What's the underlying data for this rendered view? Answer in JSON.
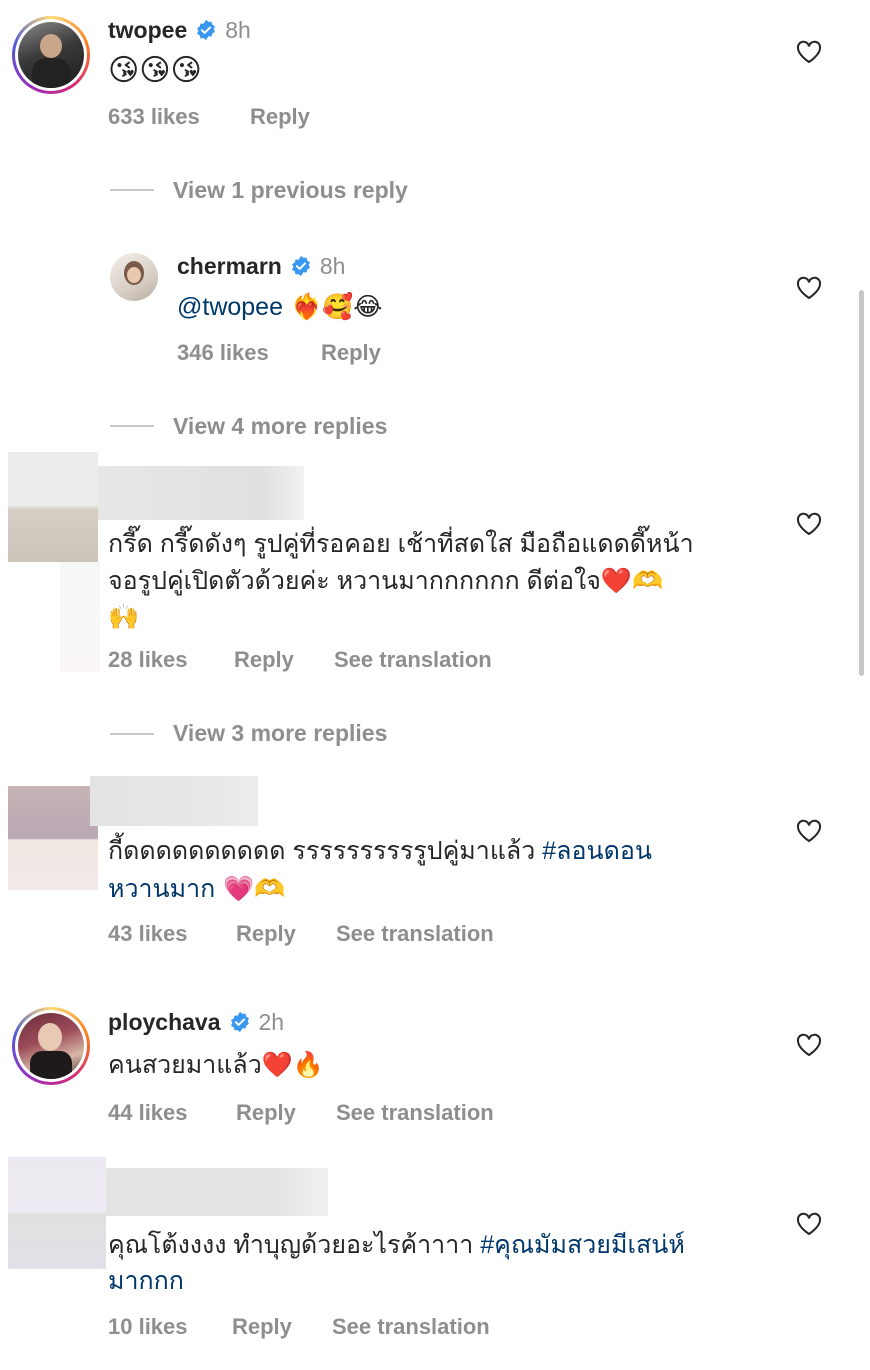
{
  "comments": [
    {
      "username": "twopee",
      "time": "8h",
      "text": "😘😘😘",
      "likes": "633 likes",
      "reply": "Reply"
    },
    {
      "username": "chermarn",
      "time": "8h",
      "mention": "@twopee",
      "text_after": " ❤️‍🔥🥰😂",
      "likes": "346 likes",
      "reply": "Reply"
    },
    {
      "text_line1": "กรี๊ด กรี๊ดดังๆ รูปคู่ที่รอคอย เช้าที่สดใส มือถือแดดดี๊หน้า",
      "text_line2": "จอรูปคู่เปิดตัวด้วยค่ะ หวานมากกกกกก ดีต่อใจ❤️🫶",
      "text_line3": "🙌",
      "likes": "28 likes",
      "reply": "Reply",
      "translate": "See translation"
    },
    {
      "text_line1": "กี้ดดดดดดดดดด รรรรรรรรรรูปคู่มาแล้ว ",
      "hashtag1": "#ลอนดอน",
      "hashtag2": "หวานมาก",
      "emoji": " 💗🫶",
      "likes": "43 likes",
      "reply": "Reply",
      "translate": "See translation"
    },
    {
      "username": "ploychava",
      "time": "2h",
      "text": "คนสวยมาแล้ว❤️🔥",
      "likes": "44 likes",
      "reply": "Reply",
      "translate": "See translation"
    },
    {
      "text_line1": "คุณโต้งงงง ทำบุญด้วยอะไรค้าาาา ",
      "hashtag1": "#คุณมัมสวยมีเสน่ห์",
      "hashtag2": "มากกก",
      "likes": "10 likes",
      "reply": "Reply",
      "translate": "See translation"
    }
  ],
  "view_links": {
    "previous": "View 1 previous reply",
    "more4": "View 4 more replies",
    "more3": "View 3 more replies"
  },
  "icons": {
    "heart": "heart-outline-icon",
    "verified": "verified-badge-icon"
  },
  "colors": {
    "text": "#262626",
    "muted": "#8e8e8e",
    "link": "#00376b",
    "verified": "#3897f0"
  }
}
